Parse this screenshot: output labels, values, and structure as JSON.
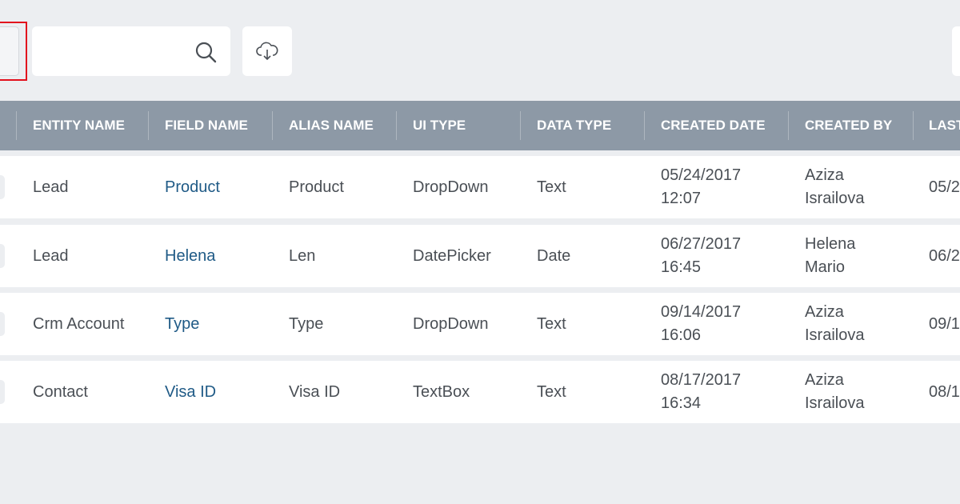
{
  "toolbar": {
    "search": {
      "value": "",
      "placeholder": ""
    },
    "search_icon": "search-icon",
    "download_icon": "cloud-download-icon"
  },
  "table": {
    "columns": [
      "ENTITY NAME",
      "FIELD NAME",
      "ALIAS NAME",
      "UI TYPE",
      "DATA TYPE",
      "CREATED DATE",
      "CREATED BY",
      "LAST"
    ],
    "rows": [
      {
        "entity": "Lead",
        "field": "Product",
        "alias": "Product",
        "ui_type": "DropDown",
        "data_type": "Text",
        "created_date": "05/24/2017",
        "created_time": "12:07",
        "created_by_first": "Aziza",
        "created_by_last": "Israilova",
        "last": "05/2"
      },
      {
        "entity": "Lead",
        "field": "Helena",
        "alias": "Len",
        "ui_type": "DatePicker",
        "data_type": "Date",
        "created_date": "06/27/2017",
        "created_time": "16:45",
        "created_by_first": "Helena",
        "created_by_last": "Mario",
        "last": "06/2"
      },
      {
        "entity": "Crm Account",
        "field": "Type",
        "alias": "Type",
        "ui_type": "DropDown",
        "data_type": "Text",
        "created_date": "09/14/2017",
        "created_time": "16:06",
        "created_by_first": "Aziza",
        "created_by_last": "Israilova",
        "last": "09/1"
      },
      {
        "entity": "Contact",
        "field": "Visa ID",
        "alias": "Visa ID",
        "ui_type": "TextBox",
        "data_type": "Text",
        "created_date": "08/17/2017",
        "created_time": "16:34",
        "created_by_first": "Aziza",
        "created_by_last": "Israilova",
        "last": "08/1"
      }
    ]
  },
  "colors": {
    "header_bg": "#8d99a6",
    "link": "#1f5a86",
    "highlight": "#e2101d",
    "page_bg": "#eceef1"
  }
}
